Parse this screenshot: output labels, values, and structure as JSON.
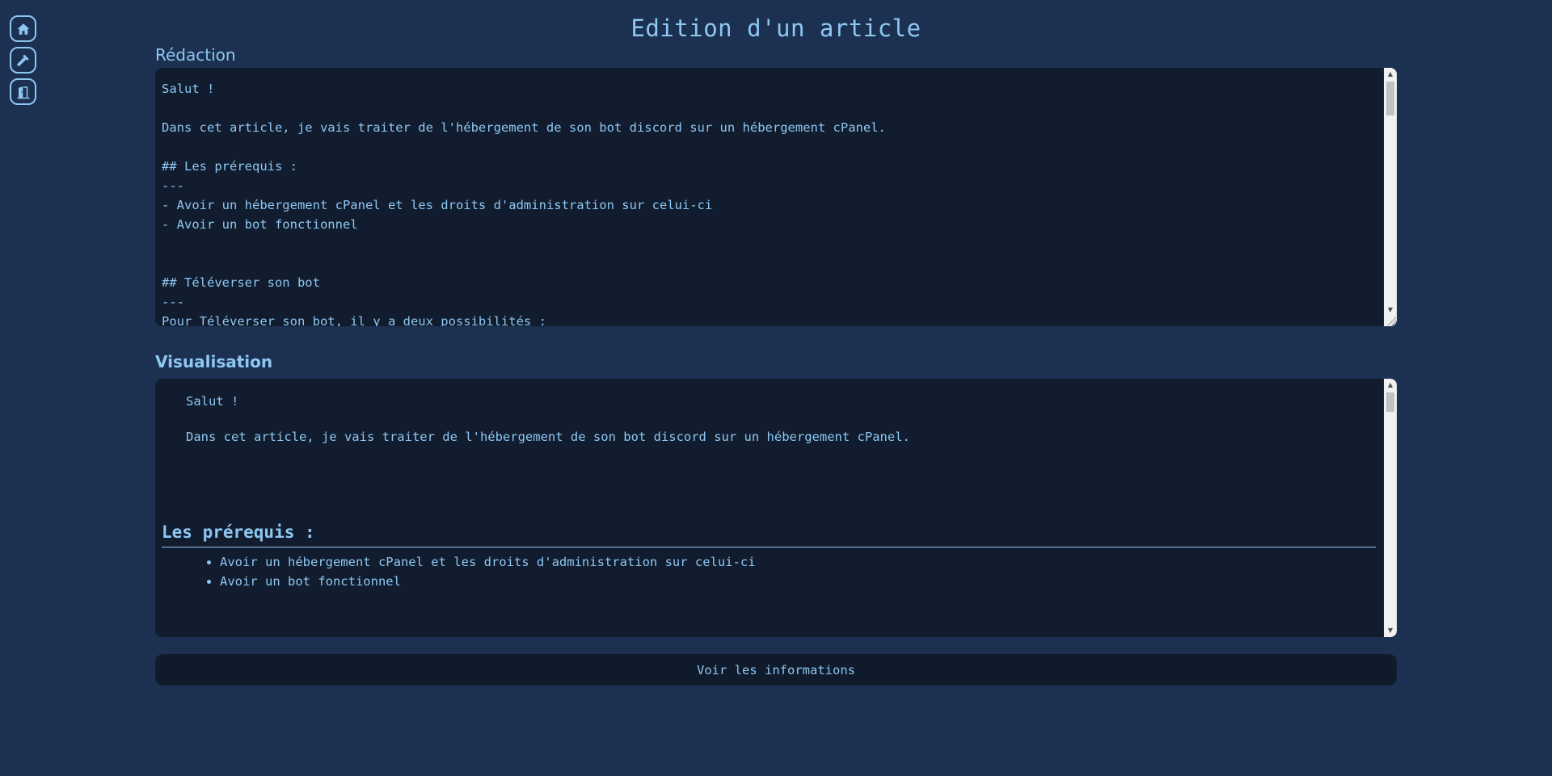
{
  "sidebar": {
    "items": [
      {
        "name": "home",
        "icon": "home-icon"
      },
      {
        "name": "tools",
        "icon": "hammer-icon"
      },
      {
        "name": "logout",
        "icon": "door-exit-icon"
      }
    ]
  },
  "page": {
    "title": "Edition d'un article"
  },
  "editor": {
    "label": "Rédaction",
    "content": "Salut !\n\nDans cet article, je vais traiter de l'hébergement de son bot discord sur un hébergement cPanel.\n\n## Les prérequis :\n---\n- Avoir un hébergement cPanel et les droits d'administration sur celui-ci\n- Avoir un bot fonctionnel\n\n\n## Téléverser son bot\n---\nPour Téléverser son bot, il y a deux possibilités :"
  },
  "preview": {
    "label": "Visualisation",
    "paragraphs": [
      "Salut !",
      "Dans cet article, je vais traiter de l'hébergement de son bot discord sur un hébergement cPanel."
    ],
    "heading": "Les prérequis :",
    "list": [
      "Avoir un hébergement cPanel et les droits d'administration sur celui-ci",
      "Avoir un bot fonctionnel"
    ]
  },
  "actions": {
    "info_button_label": "Voir les informations"
  },
  "colors": {
    "background": "#1c3151",
    "panel": "#111c2e",
    "accent": "#8ec7f2"
  }
}
